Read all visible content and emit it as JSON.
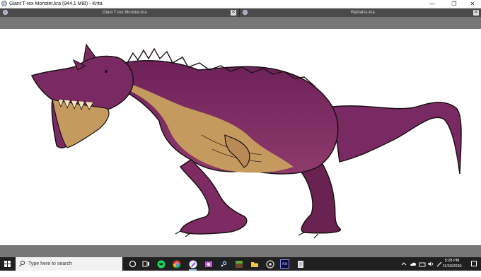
{
  "window": {
    "title": "Giant T-rex Monster.kra (944.1 MiB)  - Krita",
    "minimize_glyph": "—",
    "maximize_glyph": "❐",
    "close_glyph": "✕"
  },
  "tabs": [
    {
      "label": "Giant T-rex Monster.kra",
      "icon": "krita-doc-icon",
      "close_glyph": "✕"
    },
    {
      "label": "Rathalos.kra",
      "icon": "krita-doc-icon",
      "close_glyph": "✕"
    }
  ],
  "canvas": {
    "subject": "dinosaur-drawing",
    "colors": {
      "body": "#7e2a63",
      "belly": "#c59a5e",
      "outline": "#1a1014",
      "shadow": "#5a1f4a"
    }
  },
  "taskbar": {
    "search_placeholder": "Type here to search",
    "apps": [
      {
        "name": "cortana-icon"
      },
      {
        "name": "task-view-icon"
      },
      {
        "name": "spotify-icon"
      },
      {
        "name": "chrome-icon"
      },
      {
        "name": "krita-icon",
        "active": true
      },
      {
        "name": "snip-icon"
      },
      {
        "name": "steam-icon"
      },
      {
        "name": "minecraft-icon"
      },
      {
        "name": "file-explorer-icon"
      },
      {
        "name": "obs-icon"
      },
      {
        "name": "animate-icon",
        "label": "An"
      },
      {
        "name": "notepad-icon"
      }
    ],
    "time": "5:28 PM",
    "date": "11/30/2020"
  }
}
